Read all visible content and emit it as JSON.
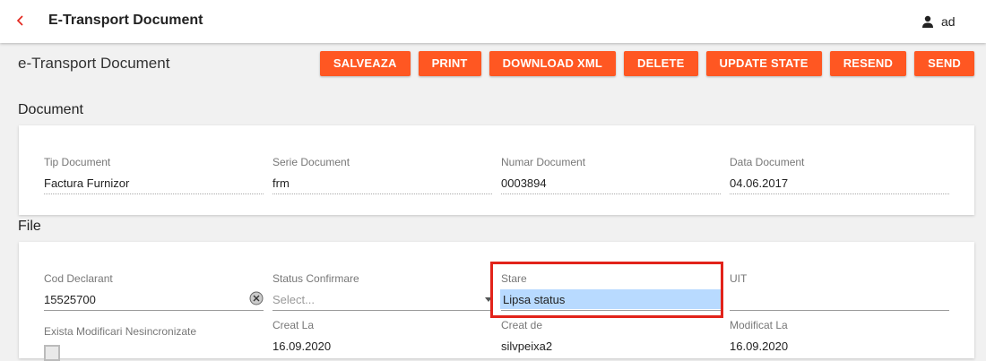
{
  "header": {
    "title": "E-Transport Document",
    "user_name": "ad"
  },
  "page": {
    "title": "e-Transport Document"
  },
  "actions": [
    {
      "label": "SALVEAZA"
    },
    {
      "label": "PRINT"
    },
    {
      "label": "DOWNLOAD XML"
    },
    {
      "label": "DELETE"
    },
    {
      "label": "UPDATE STATE"
    },
    {
      "label": "RESEND"
    },
    {
      "label": "SEND"
    }
  ],
  "document_section": {
    "title": "Document",
    "fields": {
      "tip_document": {
        "label": "Tip Document",
        "value": "Factura Furnizor"
      },
      "serie_document": {
        "label": "Serie Document",
        "value": "frm"
      },
      "numar_document": {
        "label": "Numar Document",
        "value": "0003894"
      },
      "data_document": {
        "label": "Data Document",
        "value": "04.06.2017"
      }
    }
  },
  "file_section": {
    "title": "File",
    "fields": {
      "cod_declarant": {
        "label": "Cod Declarant",
        "value": "15525700"
      },
      "status_confirmare": {
        "label": "Status Confirmare",
        "placeholder": "Select..."
      },
      "stare": {
        "label": "Stare",
        "value": "Lipsa status"
      },
      "uit": {
        "label": "UIT",
        "value": ""
      },
      "exista_modificari": {
        "label": "Exista Modificari Nesincronizate"
      },
      "creat_la": {
        "label": "Creat La",
        "value": "16.09.2020"
      },
      "creat_de": {
        "label": "Creat de",
        "value": "silvpeixa2"
      },
      "modificat_la": {
        "label": "Modificat La",
        "value": "16.09.2020"
      }
    }
  },
  "colors": {
    "accent": "#ff5722",
    "highlight": "#b8daff",
    "annotation": "#e2231a"
  }
}
